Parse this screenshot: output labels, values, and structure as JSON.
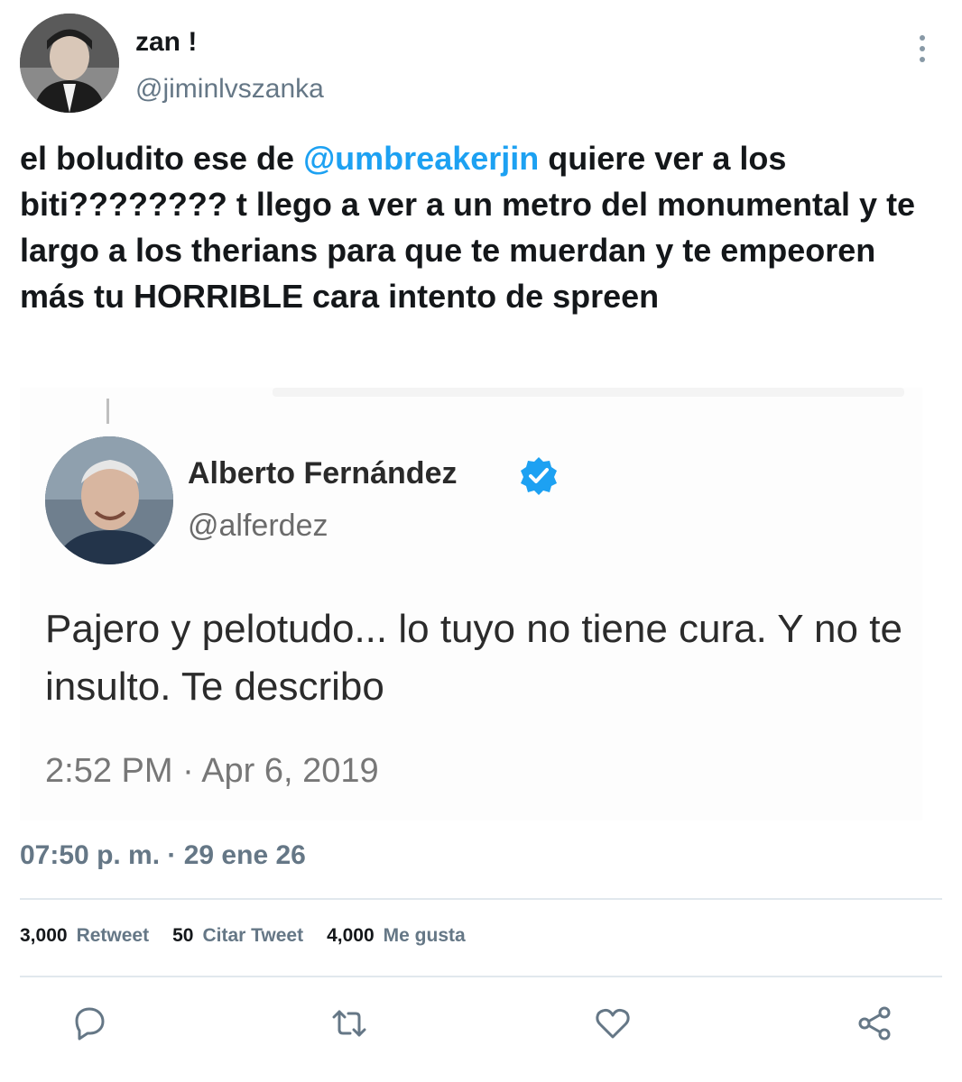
{
  "tweet": {
    "author": {
      "display_name": "zan !",
      "handle": "@jiminlvszanka",
      "avatar_icon": "avatar-photo"
    },
    "text": {
      "part1": "el boludito ese de ",
      "mention": "@umbreakerjin",
      "part2": " quiere ver a los biti???????? t llego a ver a un metro del monumental y te largo a los therians para que te muerdan y te empeoren más tu HORRIBLE cara intento de spreen"
    },
    "timestamp": "07:50 p. m. · 29 ene 26",
    "stats": [
      {
        "count": "3,000",
        "label": "Retweet"
      },
      {
        "count": "50",
        "label": "Citar Tweet"
      },
      {
        "count": "4,000",
        "label": "Me gusta"
      }
    ],
    "actions": [
      "reply-icon",
      "retweet-icon",
      "like-icon",
      "share-icon"
    ]
  },
  "media_screenshot": {
    "name": "Alberto Fernández",
    "handle": "@alferdez",
    "text": "Pajero y pelotudo... lo tuyo no tiene cura. Y no te insulto. Te describo",
    "time": "2:52 PM · Apr 6, 2019",
    "verified_color": "#1da1f2"
  },
  "colors": {
    "accent": "#1da1f2",
    "secondary_text": "#657786",
    "divider": "#e1e8ed"
  }
}
